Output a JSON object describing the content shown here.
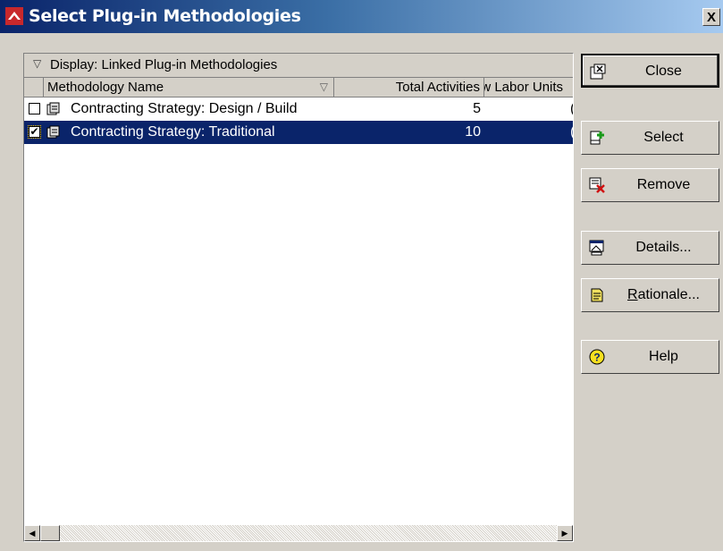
{
  "window": {
    "title": "Select Plug-in Methodologies",
    "close_glyph": "X"
  },
  "grid": {
    "group_label": "Display: Linked Plug-in Methodologies",
    "columns": [
      "Methodology Name",
      "Total Activities",
      "ow Labor Units"
    ],
    "rows": [
      {
        "checked": false,
        "check_glyph": "",
        "name": "Contracting Strategy: Design / Build",
        "total_activities": "5",
        "labor_units": "("
      },
      {
        "checked": true,
        "check_glyph": "✔",
        "name": "Contracting Strategy: Traditional",
        "total_activities": "10",
        "labor_units": "("
      }
    ]
  },
  "buttons": {
    "close": "Close",
    "select": "Select",
    "remove": "Remove",
    "details": "Details...",
    "rationale_mnemonic": "R",
    "rationale_rest": "ationale...",
    "help": "Help"
  },
  "icons": {
    "app": "methodology-app-icon",
    "close": "window-close-icon",
    "select": "green-plus-icon",
    "remove": "red-x-icon",
    "details": "details-icon",
    "rationale": "document-icon",
    "help": "question-mark-icon"
  },
  "colors": {
    "title_start": "#0a246a",
    "title_end": "#a6caf0",
    "selection": "#0a246a",
    "face": "#d4d0c8"
  }
}
